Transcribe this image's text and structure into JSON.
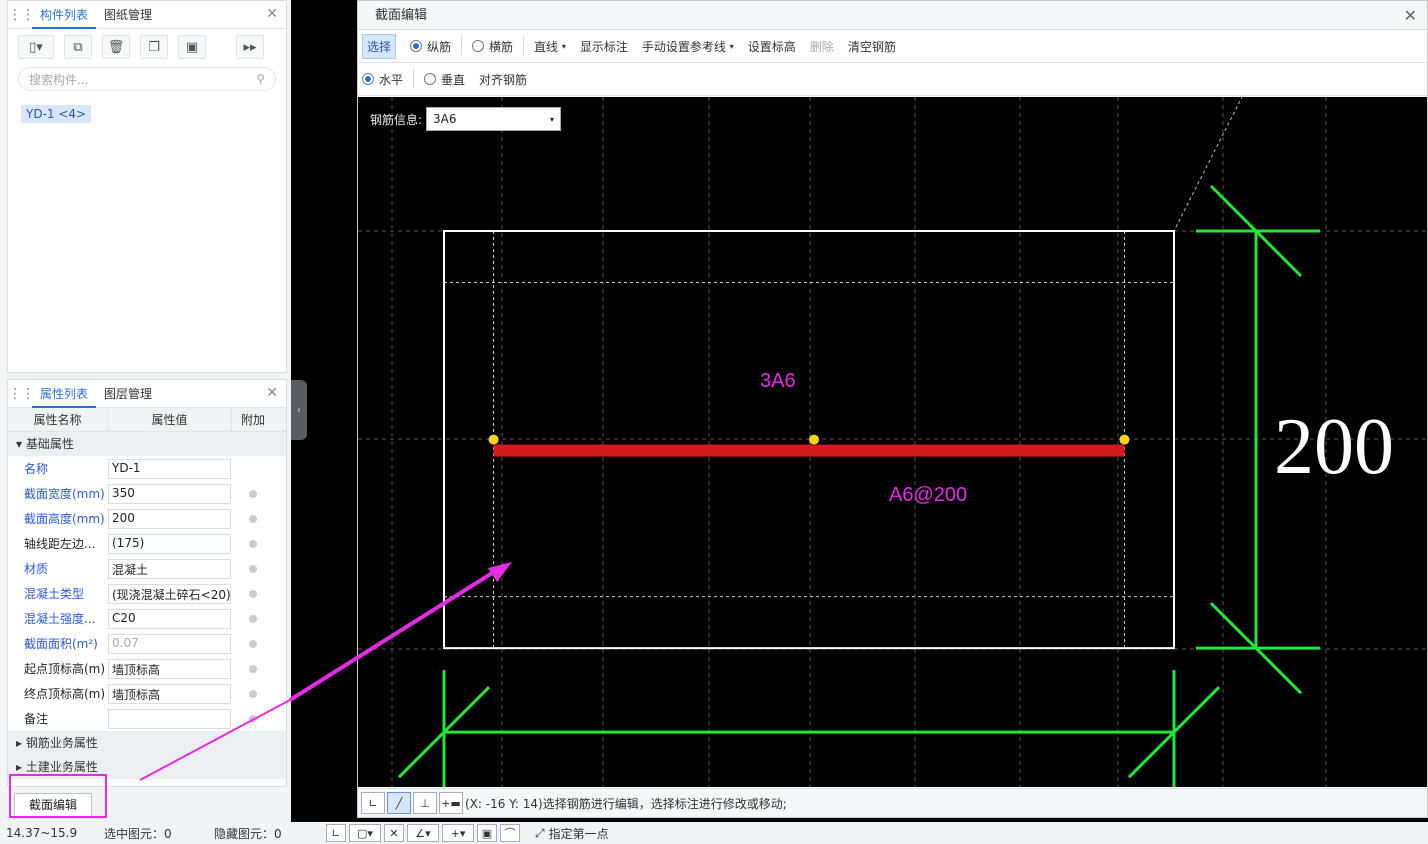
{
  "left_panel": {
    "top_tabs": [
      "构件列表",
      "图纸管理"
    ],
    "search_placeholder": "搜索构件...",
    "component_chip": "YD-1 <4>",
    "bottom_tabs": [
      "属性列表",
      "图层管理"
    ],
    "prop_headers": [
      "属性名称",
      "属性值",
      "附加"
    ],
    "group_basic": "基础属性",
    "properties": [
      {
        "name": "名称",
        "value": "YD-1",
        "blue": true,
        "dot": false,
        "gray": false
      },
      {
        "name": "截面宽度(mm)",
        "value": "350",
        "blue": true,
        "dot": true,
        "gray": false
      },
      {
        "name": "截面高度(mm)",
        "value": "200",
        "blue": true,
        "dot": true,
        "gray": false
      },
      {
        "name": "轴线距左边...",
        "value": "(175)",
        "blue": false,
        "dot": true,
        "gray": false
      },
      {
        "name": "材质",
        "value": "混凝土",
        "blue": true,
        "dot": true,
        "gray": false
      },
      {
        "name": "混凝土类型",
        "value": "(现浇混凝土碎石<20)",
        "blue": true,
        "dot": true,
        "gray": false
      },
      {
        "name": "混凝土强度...",
        "value": "C20",
        "blue": true,
        "dot": true,
        "gray": false
      },
      {
        "name": "截面面积(m²)",
        "value": "0.07",
        "blue": true,
        "dot": true,
        "gray": true
      },
      {
        "name": "起点顶标高(m)",
        "value": "墙顶标高",
        "blue": false,
        "dot": true,
        "gray": false
      },
      {
        "name": "终点顶标高(m)",
        "value": "墙顶标高",
        "blue": false,
        "dot": true,
        "gray": false
      },
      {
        "name": "备注",
        "value": "",
        "blue": false,
        "dot": true,
        "gray": false
      }
    ],
    "group_rebar": "钢筋业务属性",
    "group_civil": "土建业务属性",
    "section_button": "截面编辑"
  },
  "dialog": {
    "title": "截面编辑",
    "toolbar1": {
      "select": "选择",
      "longitudinal": "纵筋",
      "transverse": "横筋",
      "line": "直线",
      "show_dim": "显示标注",
      "manual_ref": "手动设置参考线",
      "set_elev": "设置标高",
      "delete": "删除",
      "clear": "清空钢筋"
    },
    "toolbar2": {
      "horizontal": "水平",
      "vertical": "垂直",
      "align": "对齐钢筋"
    },
    "rebar_info_label": "钢筋信息:",
    "rebar_info_value": "3A6",
    "status_text": "(X: -16 Y: 14)选择钢筋进行编辑，选择标注进行修改或移动;"
  },
  "chart_data": {
    "type": "diagram",
    "section": {
      "width": 350,
      "height": 200
    },
    "top_rebar_label": "3A6",
    "distribution_label": "A6@200",
    "height_dim_label": "200",
    "colors": {
      "section": "#ffffff",
      "rebar": "#d4191f",
      "dim": "#22e63a",
      "label": "#e62be6",
      "grip": "#ffd21a"
    }
  },
  "status_bar": {
    "coords": "14.37~15.9",
    "selected": "选中图元：0",
    "hidden": "隐藏图元：0",
    "prompt": "指定第一点"
  }
}
